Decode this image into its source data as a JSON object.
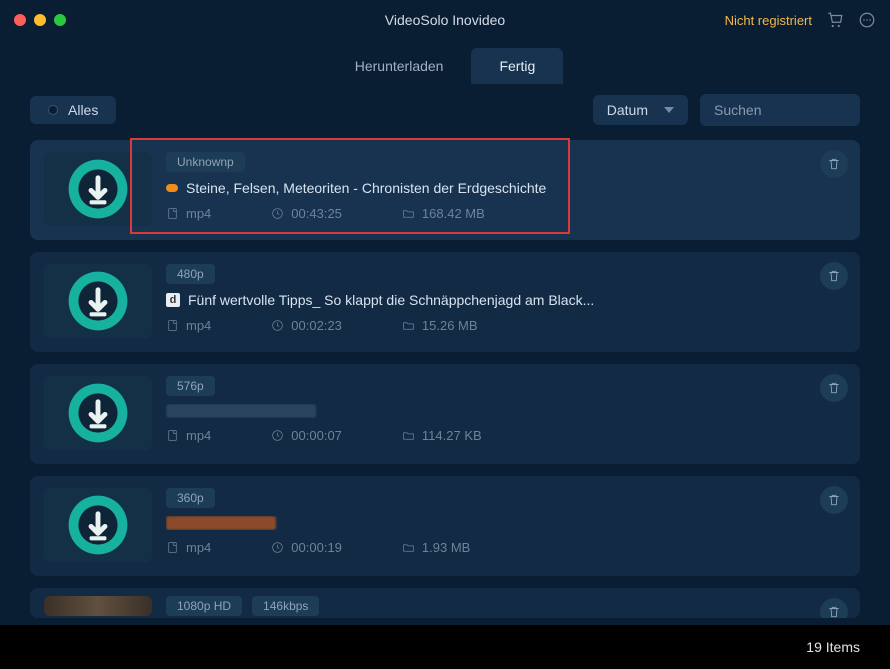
{
  "window": {
    "title": "VideoSolo Inovideo",
    "not_registered": "Nicht registriert"
  },
  "tabs": {
    "download": "Herunterladen",
    "done": "Fertig"
  },
  "toolbar": {
    "alles": "Alles",
    "sort_label": "Datum",
    "search_placeholder": "Suchen"
  },
  "items": [
    {
      "quality": "Unknownp",
      "title": "Steine, Felsen, Meteoriten - Chronisten der Erdgeschichte",
      "format": "mp4",
      "duration": "00:43:25",
      "size": "168.42 MB",
      "icon_type": "orange",
      "selected": true,
      "highlighted": true
    },
    {
      "quality": "480p",
      "title": "Fünf wertvolle Tipps_ So klappt die Schnäppchenjagd am Black...",
      "format": "mp4",
      "duration": "00:02:23",
      "size": "15.26 MB",
      "icon_type": "square",
      "selected": false
    },
    {
      "quality": "576p",
      "title": "",
      "format": "mp4",
      "duration": "00:00:07",
      "size": "114.27 KB",
      "icon_type": "blur",
      "selected": false
    },
    {
      "quality": "360p",
      "title": "",
      "format": "mp4",
      "duration": "00:00:19",
      "size": "1.93 MB",
      "icon_type": "blur_orange",
      "selected": false
    },
    {
      "quality": "1080p HD",
      "extra_badge": "146kbps",
      "title": "",
      "format": "",
      "duration": "",
      "size": "",
      "icon_type": "photo",
      "cut": true
    }
  ],
  "footer": {
    "count": "19 Items"
  }
}
